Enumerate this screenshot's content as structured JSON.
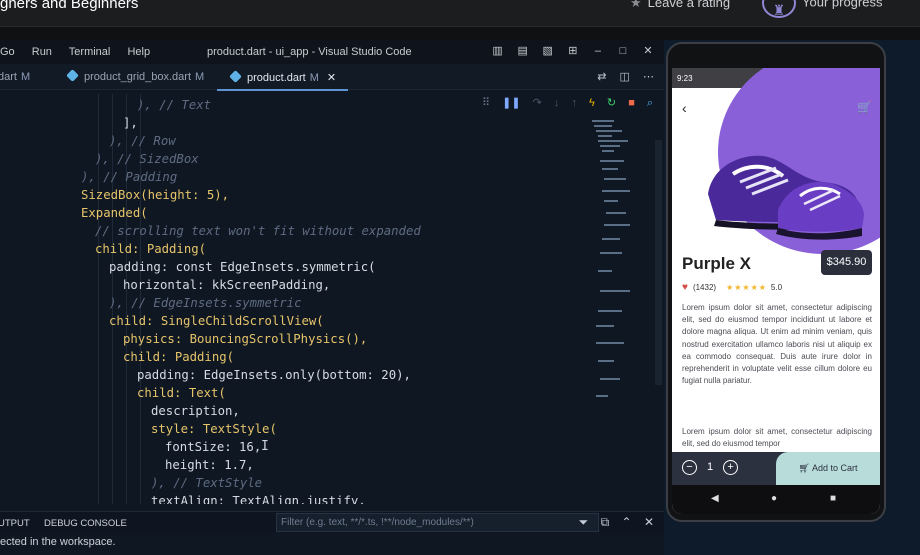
{
  "header": {
    "course_title": "gners and Beginners",
    "rating_label": "Leave a rating",
    "progress_label": "Your progress"
  },
  "vscode": {
    "menu": [
      "Go",
      "Run",
      "Terminal",
      "Help"
    ],
    "window_title": "product.dart - ui_app - Visual Studio Code",
    "tabs": [
      {
        "name": "dart",
        "modified": "M"
      },
      {
        "name": "product_grid_box.dart",
        "modified": "M"
      },
      {
        "name": "product.dart",
        "modified": "M"
      }
    ],
    "code_lines": [
      "), // Text",
      "],",
      "), // Row",
      "), // SizedBox",
      "), // Padding",
      "SizedBox(height: 5),",
      "Expanded(",
      "// scrolling text won't fit without expanded",
      "child: Padding(",
      "padding: const EdgeInsets.symmetric(",
      "horizontal: kkScreenPadding,",
      "), // EdgeInsets.symmetric",
      "child: SingleChildScrollView(",
      "physics: BouncingScrollPhysics(),",
      "child: Padding(",
      "padding: EdgeInsets.only(bottom: 20),",
      "child: Text(",
      "description,",
      "style: TextStyle(",
      "fontSize: 16,",
      "height: 1.7,",
      "), // TextStyle",
      "textAlign: TextAlign.justify,"
    ],
    "panel": {
      "tabs": [
        "UTPUT",
        "DEBUG CONSOLE"
      ],
      "filter_placeholder": "Filter (e.g. text, **/*.ts, !**/node_modules/**)"
    },
    "status_text": "ected in the workspace."
  },
  "phone": {
    "status_time": "9:23",
    "status_right": "⊖ ▾ ◢ ▮",
    "product_name": "Purple X",
    "price": "$345.90",
    "review_count": "(1432)",
    "stars": "★★★★★",
    "rating": "5.0",
    "description": "Lorem ipsum dolor sit amet, consectetur adipiscing elit, sed do eiusmod tempor incididunt ut labore et dolore magna aliqua. Ut enim ad minim veniam, quis nostrud exercitation ullamco laboris nisi ut aliquip ex ea commodo consequat. Duis aute irure dolor in reprehenderit in voluptate velit esse cillum dolore eu fugiat nulla pariatur.",
    "description_repeat": "Lorem ipsum dolor sit amet, consectetur adipiscing elit, sed do eiusmod tempor",
    "quantity": "1",
    "add_to_cart": "Add to Cart"
  },
  "colors": {
    "accent_purple": "#8a60d8",
    "price_bg": "#2b2f3c",
    "cart_bg": "#b8dcd9",
    "editor_bg": "#0f1722"
  }
}
